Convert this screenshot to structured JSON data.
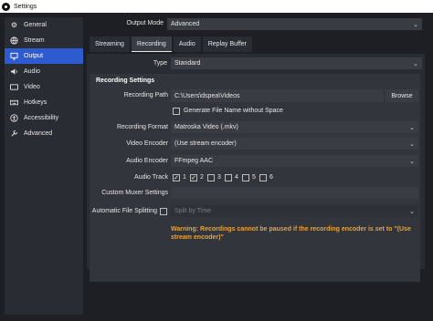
{
  "window": {
    "title": "Settings"
  },
  "sidebar": {
    "items": [
      {
        "label": "General",
        "icon": "gear-icon"
      },
      {
        "label": "Stream",
        "icon": "globe-icon"
      },
      {
        "label": "Output",
        "icon": "monitor-icon"
      },
      {
        "label": "Audio",
        "icon": "speaker-icon"
      },
      {
        "label": "Video",
        "icon": "video-icon"
      },
      {
        "label": "Hotkeys",
        "icon": "keyboard-icon"
      },
      {
        "label": "Accessibility",
        "icon": "accessibility-icon"
      },
      {
        "label": "Advanced",
        "icon": "wrench-icon"
      }
    ],
    "active": "Output"
  },
  "output_mode": {
    "label": "Output Mode",
    "value": "Advanced"
  },
  "tabs": [
    {
      "label": "Streaming"
    },
    {
      "label": "Recording"
    },
    {
      "label": "Audio"
    },
    {
      "label": "Replay Buffer"
    }
  ],
  "type": {
    "label": "Type",
    "value": "Standard"
  },
  "recording_settings": {
    "title": "Recording Settings",
    "path_label": "Recording Path",
    "path_value": "C:\\Users\\dspea\\Videos",
    "browse_label": "Browse",
    "no_space_label": "Generate File Name without Space",
    "no_space_checked": false,
    "format_label": "Recording Format",
    "format_value": "Matroska Video (.mkv)",
    "video_encoder_label": "Video Encoder",
    "video_encoder_value": "(Use stream encoder)",
    "audio_encoder_label": "Audio Encoder",
    "audio_encoder_value": "FFmpeg AAC",
    "audio_track_label": "Audio Track",
    "tracks": [
      {
        "label": "1",
        "checked": true
      },
      {
        "label": "2",
        "checked": true
      },
      {
        "label": "3",
        "checked": false
      },
      {
        "label": "4",
        "checked": false
      },
      {
        "label": "5",
        "checked": false
      },
      {
        "label": "6",
        "checked": false
      }
    ],
    "muxer_label": "Custom Muxer Settings",
    "muxer_value": "",
    "split_label": "Automatic File Splitting",
    "split_checked": false,
    "split_value": "Split by Time",
    "warning": "Warning: Recordings cannot be paused if the recording encoder is set to \"(Use stream encoder)\""
  },
  "colors": {
    "accent": "#2f5bd1",
    "warning": "#e7a43a",
    "background": "#1e1f24",
    "panel": "#2a2c33"
  }
}
